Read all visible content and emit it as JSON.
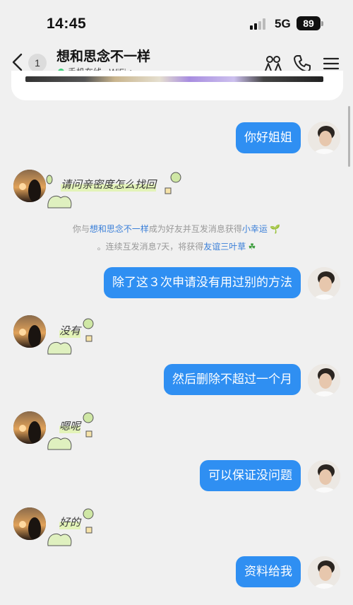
{
  "status": {
    "time": "14:45",
    "network": "5G",
    "battery": "89"
  },
  "header": {
    "unread_count": "1",
    "title": "想和思念不一样",
    "online_status": "手机在线 - WiFi",
    "subtitle_chevron": "›"
  },
  "messages": [
    {
      "side": "out",
      "text": "你好姐姐"
    },
    {
      "side": "in",
      "sticker_text": "请问亲密度怎么找回"
    },
    {
      "side": "out",
      "text": "除了这３次申请没有用过别的方法"
    },
    {
      "side": "in",
      "sticker_text": "没有"
    },
    {
      "side": "out",
      "text": "然后删除不超过一个月"
    },
    {
      "side": "in",
      "sticker_text": "嗯呢"
    },
    {
      "side": "out",
      "text": "可以保证没问题"
    },
    {
      "side": "in",
      "sticker_text": "好的"
    },
    {
      "side": "out",
      "text": "资料给我"
    }
  ],
  "system_notice": {
    "part1": "你与",
    "name": "想和思念不一样",
    "part2": "成为好友并互发消息获得",
    "badge1": "小幸运",
    "part3": "。连续互发消息7天，将获得",
    "badge2": "友谊三叶草"
  },
  "icons": [
    "back-icon",
    "friends-icon",
    "phone-icon",
    "menu-icon",
    "sprout-icon",
    "clover-icon"
  ],
  "colors": {
    "bubble_out": "#2f8ff2",
    "background": "#f0f0f0",
    "online": "#3fd07a",
    "link": "#3a7fd8"
  }
}
